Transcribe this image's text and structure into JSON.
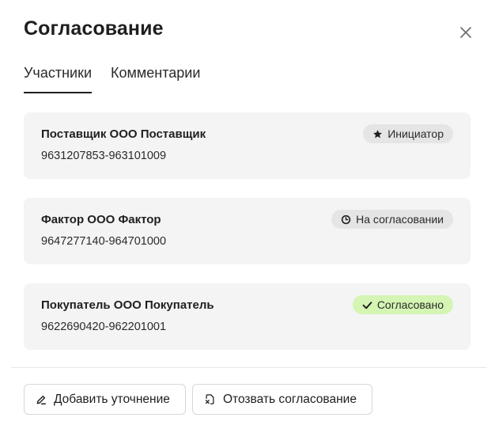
{
  "dialog": {
    "title": "Согласование",
    "close_icon": "close-icon"
  },
  "tabs": [
    {
      "label": "Участники",
      "active": true
    },
    {
      "label": "Комментарии",
      "active": false
    }
  ],
  "participants": [
    {
      "name": "Поставщик ООО Поставщик",
      "ids": "9631207853-963101009",
      "badge": "Инициатор",
      "badge_icon": "star-icon",
      "badge_color": "#e5e5e5"
    },
    {
      "name": "Фактор ООО Фактор",
      "ids": "9647277140-964701000",
      "badge": "На согласовании",
      "badge_icon": "clock-icon",
      "badge_color": "#e5e5e5"
    },
    {
      "name": "Покупатель ООО Покупатель",
      "ids": "9622690420-962201001",
      "badge": "Согласовано",
      "badge_icon": "check-icon",
      "badge_color": "#d4f5b3"
    }
  ],
  "actions": {
    "add_clarification": "Добавить уточнение",
    "add_clarification_icon": "pencil-icon",
    "revoke_approval": "Отозвать согласование",
    "revoke_approval_icon": "file-cancel-icon"
  }
}
